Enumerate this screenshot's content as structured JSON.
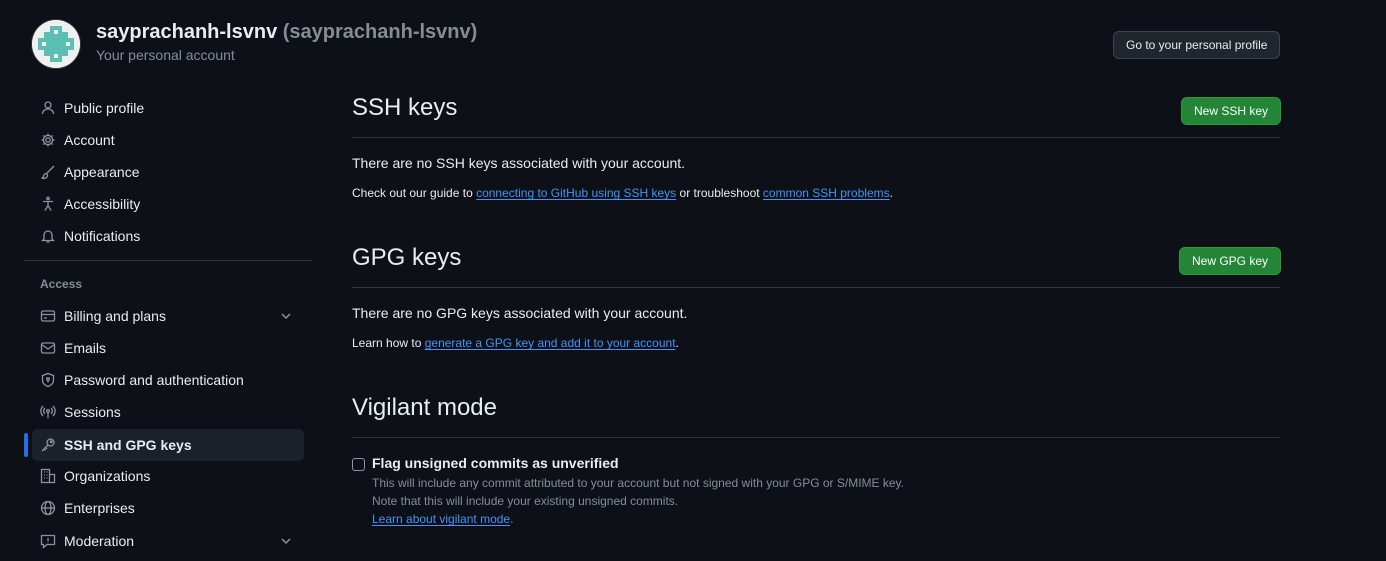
{
  "header": {
    "name": "sayprachanh-lsvnv",
    "login": "(sayprachanh-lsvnv)",
    "subtitle": "Your personal account",
    "profile_button": "Go to your personal profile"
  },
  "sidebar": {
    "items": [
      {
        "label": "Public profile",
        "icon": "person-icon"
      },
      {
        "label": "Account",
        "icon": "gear-icon"
      },
      {
        "label": "Appearance",
        "icon": "paintbrush-icon"
      },
      {
        "label": "Accessibility",
        "icon": "accessibility-icon"
      },
      {
        "label": "Notifications",
        "icon": "bell-icon"
      }
    ],
    "access_heading": "Access",
    "access_items": [
      {
        "label": "Billing and plans",
        "icon": "credit-card-icon",
        "expandable": true
      },
      {
        "label": "Emails",
        "icon": "mail-icon"
      },
      {
        "label": "Password and authentication",
        "icon": "shield-lock-icon"
      },
      {
        "label": "Sessions",
        "icon": "broadcast-icon"
      },
      {
        "label": "SSH and GPG keys",
        "icon": "key-icon",
        "active": true
      },
      {
        "label": "Organizations",
        "icon": "organization-icon"
      },
      {
        "label": "Enterprises",
        "icon": "globe-icon"
      },
      {
        "label": "Moderation",
        "icon": "report-icon",
        "expandable": true
      }
    ]
  },
  "ssh": {
    "title": "SSH keys",
    "button": "New SSH key",
    "empty": "There are no SSH keys associated with your account.",
    "guide_pre": "Check out our guide to ",
    "guide_link": "connecting to GitHub using SSH keys",
    "guide_mid": " or troubleshoot ",
    "guide_link2": "common SSH problems",
    "guide_post": "."
  },
  "gpg": {
    "title": "GPG keys",
    "button": "New GPG key",
    "empty": "There are no GPG keys associated with your account.",
    "learn_pre": "Learn how to ",
    "learn_link": "generate a GPG key and add it to your account",
    "learn_post": "."
  },
  "vigilant": {
    "title": "Vigilant mode",
    "checkbox_label": "Flag unsigned commits as unverified",
    "checked": false,
    "desc1": "This will include any commit attributed to your account but not signed with your GPG or S/MIME key.",
    "desc2": "Note that this will include your existing unsigned commits.",
    "learn_link": "Learn about vigilant mode",
    "learn_post": "."
  },
  "colors": {
    "background": "#0d1117",
    "accent_link": "#4493f8",
    "primary_button": "#238636",
    "active_indicator": "#1f6feb"
  }
}
